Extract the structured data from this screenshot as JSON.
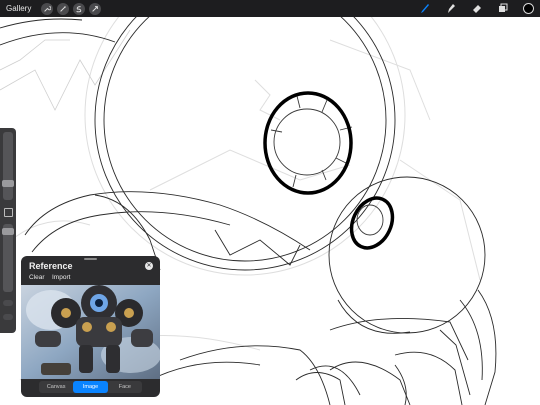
{
  "toolbar": {
    "gallery_label": "Gallery",
    "left_tools": [
      "wrench-icon",
      "magic-wand-icon",
      "selection-icon",
      "transform-arrow-icon"
    ],
    "right_tools": [
      "brush-icon",
      "smudge-icon",
      "eraser-icon",
      "layers-icon"
    ],
    "active_tool": "brush-icon",
    "accent_color": "#0a84ff",
    "current_color": "#000000"
  },
  "reference_panel": {
    "title": "Reference",
    "actions": {
      "clear_label": "Clear",
      "import_label": "Import"
    },
    "tabs": [
      {
        "label": "Canvas",
        "active": false
      },
      {
        "label": "Image",
        "active": true
      },
      {
        "label": "Face",
        "active": false
      }
    ]
  }
}
